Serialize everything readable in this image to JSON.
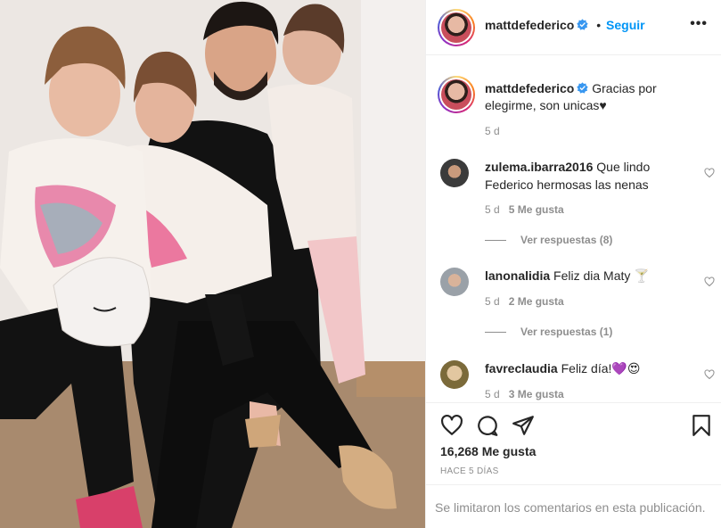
{
  "post": {
    "username": "mattdefederico",
    "follow_label": "Seguir",
    "more_label": "•••",
    "dot": "•",
    "caption_text": "Gracias por elegirme, son unicas♥",
    "caption_time": "5 d"
  },
  "comments": [
    {
      "username": "zulema.ibarra2016",
      "text": "Que lindo Federico hermosas las nenas",
      "time": "5 d",
      "likes": "5 Me gusta",
      "replies": "Ver respuestas (8)"
    },
    {
      "username": "lanonalidia",
      "text": "Feliz dia Maty 🍸",
      "time": "5 d",
      "likes": "2 Me gusta",
      "replies": "Ver respuestas (1)"
    },
    {
      "username": "favreclaudia",
      "text": "Feliz día!💜😍",
      "time": "5 d",
      "likes": "3 Me gusta"
    }
  ],
  "likes_count": "16,268 Me gusta",
  "date_label": "HACE 5 DÍAS",
  "comments_limited": "Se limitaron los comentarios en esta publicación.",
  "colors": {
    "link": "#0095f6",
    "muted": "#8e8e8e",
    "text": "#262626",
    "border": "#efefef"
  }
}
